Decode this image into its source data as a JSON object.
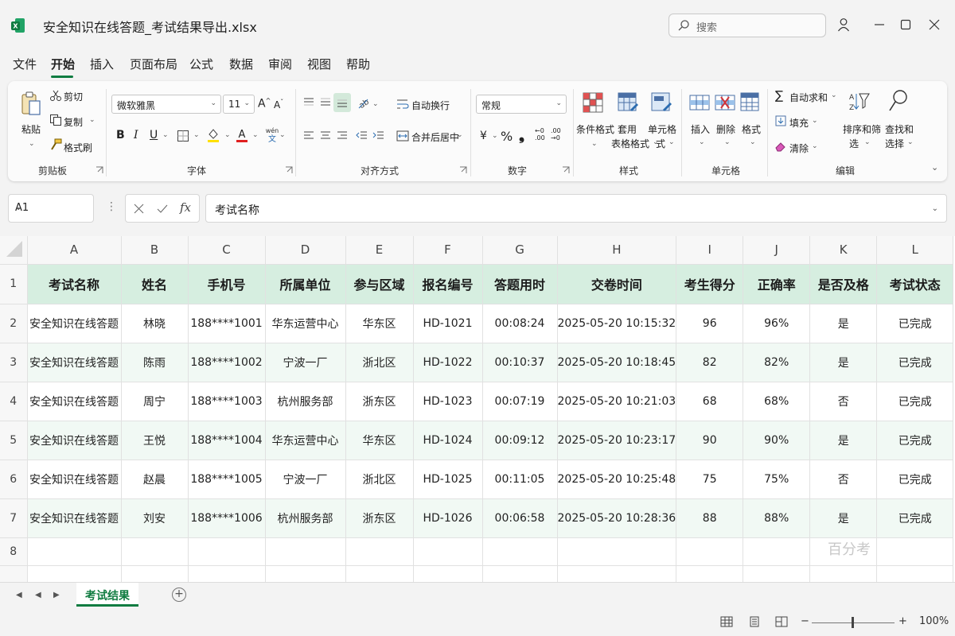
{
  "window": {
    "title": "安全知识在线答题_考试结果导出.xlsx",
    "search_placeholder": "搜索"
  },
  "menu": [
    "文件",
    "开始",
    "插入",
    "页面布局",
    "公式",
    "数据",
    "审阅",
    "视图",
    "帮助"
  ],
  "ribbon": {
    "clipboard": {
      "paste": "粘贴",
      "cut": "剪切",
      "copy": "复制",
      "format_painter": "格式刷",
      "label": "剪贴板"
    },
    "font": {
      "family": "微软雅黑",
      "size": "11",
      "bold": "B",
      "italic": "I",
      "underline": "U",
      "label": "字体"
    },
    "alignment": {
      "wrap": "自动换行",
      "merge": "合并后居中",
      "label": "对齐方式"
    },
    "number": {
      "format": "常规",
      "currency": "¥",
      "percent": "%",
      "comma": "❟",
      "inc_decimal": "←0\n.00",
      "dec_decimal": ".00\n→0",
      "label": "数字"
    },
    "styles": {
      "conditional": "条件格式",
      "table_format_1": "套用",
      "table_format_2": "格式",
      "table_format_3": "表格格式",
      "cell_style_1": "单元格",
      "cell_style_2": "式",
      "label": "样式"
    },
    "cells": {
      "insert": "插入",
      "delete": "删除",
      "format": "格式",
      "label": "单元格"
    },
    "editing": {
      "autosum": "自动求和",
      "fill": "填充",
      "clear": "清除",
      "sort_1": "排序和筛",
      "sort_2": "选",
      "find_1": "查找和",
      "find_2": "选择",
      "label": "编辑"
    }
  },
  "formula_bar": {
    "cell_ref": "A1",
    "content": "考试名称"
  },
  "columns": [
    "A",
    "B",
    "C",
    "D",
    "E",
    "F",
    "G",
    "H",
    "I",
    "J",
    "K",
    "L"
  ],
  "headers": [
    "考试名称",
    "姓名",
    "手机号",
    "所属单位",
    "参与区域",
    "报名编号",
    "答题用时",
    "交卷时间",
    "考生得分",
    "正确率",
    "是否及格",
    "考试状态"
  ],
  "rows": [
    [
      "安全知识在线答题",
      "林晓",
      "188****1001",
      "华东运营中心",
      "华东区",
      "HD-1021",
      "00:08:24",
      "2025-05-20 10:15:32",
      "96",
      "96%",
      "是",
      "已完成"
    ],
    [
      "安全知识在线答题",
      "陈雨",
      "188****1002",
      "宁波一厂",
      "浙北区",
      "HD-1022",
      "00:10:37",
      "2025-05-20 10:18:45",
      "82",
      "82%",
      "是",
      "已完成"
    ],
    [
      "安全知识在线答题",
      "周宁",
      "188****1003",
      "杭州服务部",
      "浙东区",
      "HD-1023",
      "00:07:19",
      "2025-05-20 10:21:03",
      "68",
      "68%",
      "否",
      "已完成"
    ],
    [
      "安全知识在线答题",
      "王悦",
      "188****1004",
      "华东运营中心",
      "华东区",
      "HD-1024",
      "00:09:12",
      "2025-05-20 10:23:17",
      "90",
      "90%",
      "是",
      "已完成"
    ],
    [
      "安全知识在线答题",
      "赵晨",
      "188****1005",
      "宁波一厂",
      "浙北区",
      "HD-1025",
      "00:11:05",
      "2025-05-20 10:25:48",
      "75",
      "75%",
      "否",
      "已完成"
    ],
    [
      "安全知识在线答题",
      "刘安",
      "188****1006",
      "杭州服务部",
      "浙东区",
      "HD-1026",
      "00:06:58",
      "2025-05-20 10:28:36",
      "88",
      "88%",
      "是",
      "已完成"
    ]
  ],
  "row_numbers": [
    "1",
    "2",
    "3",
    "4",
    "5",
    "6",
    "7",
    "8"
  ],
  "watermark": "百分考",
  "sheet_tab": "考试结果",
  "add_sheet": "+",
  "status": {
    "zoom": "100%",
    "zoom_minus": "−",
    "zoom_plus": "+"
  },
  "colors": {
    "accent": "#107c41",
    "header_fill": "#d6eee0",
    "alt_row": "#f1f9f4"
  }
}
